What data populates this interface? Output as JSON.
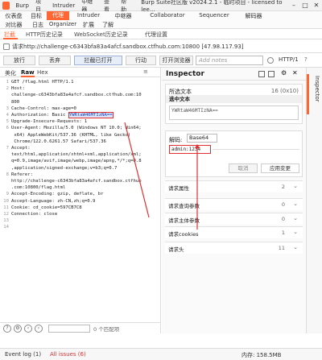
{
  "titlebar": {
    "menus": [
      "Burp",
      "项目",
      "Intruder",
      "中继器",
      "查看",
      "帮助"
    ],
    "title": "Burp Suite社区版 v2024.2.1 - 临时项目 - licensed to lee..."
  },
  "main_tabs_row1": [
    "仪表盘",
    "目标",
    "代理",
    "Intruder",
    "中继器",
    "Collaborator",
    "Sequencer",
    "解码器"
  ],
  "main_tabs_row2": [
    "对比器",
    "日志",
    "Organizer",
    "扩展",
    "了解"
  ],
  "active_main_tab": "代理",
  "sub_tabs": [
    "拦截",
    "HTTP历史记录",
    "WebSocket历史记录",
    "代理设置"
  ],
  "active_sub_tab": "拦截",
  "target": "请求http://challenge-c6343bfa83a4afcf.sandbox.ctfhub.com:10800 [47.98.117.93]",
  "toolbar": {
    "forward": "放行",
    "drop": "丢弃",
    "intercept": "拦截已打开",
    "action": "行动",
    "open_browser": "打开浏览器",
    "note_placeholder": "Add notes",
    "protocol": "HTTP/1"
  },
  "editor": {
    "tabs": [
      "美化",
      "Raw",
      "Hex"
    ],
    "active_tab": "Raw",
    "lines": [
      {
        "n": "1",
        "t": "GET /flag.html HTTP/1.1"
      },
      {
        "n": "2",
        "t": "Host:"
      },
      {
        "n": "",
        "t": "challenge-c6343bfa83a4afcf.sandbox.ctfhub.com:10"
      },
      {
        "n": "",
        "t": "800"
      },
      {
        "n": "3",
        "t": "Cache-Control: max-age=0"
      },
      {
        "n": "4",
        "t": "Authorization: Basic ",
        "h": "YWRtaW46MTIzNA=="
      },
      {
        "n": "5",
        "t": "Upgrade-Insecure-Requests: 1"
      },
      {
        "n": "6",
        "t": "User-Agent: Mozilla/5.0 (Windows NT 10.0; Win64;"
      },
      {
        "n": "",
        "t": " x64) AppleWebKit/537.36 (KHTML, like Gecko)"
      },
      {
        "n": "",
        "t": " Chrome/122.0.6261.57 Safari/537.36"
      },
      {
        "n": "7",
        "t": "Accept:"
      },
      {
        "n": "",
        "t": "text/html,application/xhtml+xml,application/xml;"
      },
      {
        "n": "",
        "t": "q=0.9,image/avif,image/webp,image/apng,*/*;q=0.8"
      },
      {
        "n": "",
        "t": ",application/signed-exchange;v=b3;q=0.7"
      },
      {
        "n": "8",
        "t": "Referer:"
      },
      {
        "n": "",
        "t": "http://challenge-c6343bfa83a4afcf.sandbox.ctfhub"
      },
      {
        "n": "",
        "t": ".com:10800/flag.html"
      },
      {
        "n": "9",
        "t": "Accept-Encoding: gzip, deflate, br"
      },
      {
        "n": "10",
        "t": "Accept-Language: zh-CN,zh;q=0.9"
      },
      {
        "n": "11",
        "t": "Cookie: cd_cookie=597CB7C8"
      },
      {
        "n": "12",
        "t": "Connection: close"
      },
      {
        "n": "13",
        "t": ""
      },
      {
        "n": "14",
        "t": ""
      }
    ],
    "search_matches": "0 个匹配项"
  },
  "inspector": {
    "title": "Inspector",
    "selection_header": "所选文本",
    "selection_count": "16 (0x10)",
    "selection_section": "选中文本",
    "selection_value": "YWRtaW46MTIzNA==",
    "decoded_label": "解码:",
    "decoded_encoding": "Base64",
    "decoded_value": "admin:1234",
    "cancel": "取消",
    "apply": "应用变更",
    "panels": [
      {
        "label": "请求属性",
        "count": "2"
      },
      {
        "label": "请求查询参数",
        "count": "0"
      },
      {
        "label": "请求主体参数",
        "count": "0"
      },
      {
        "label": "请求cookies",
        "count": "1"
      },
      {
        "label": "请求头",
        "count": "11"
      }
    ]
  },
  "rail": {
    "label": "Inspector"
  },
  "statusbar": {
    "event_log": "Event log (1)",
    "all_issues": "All issues (6)",
    "memory": "内存: 158.5MB"
  },
  "colors": {
    "accent": "#ff6633",
    "highlight_border": "#e03030"
  }
}
